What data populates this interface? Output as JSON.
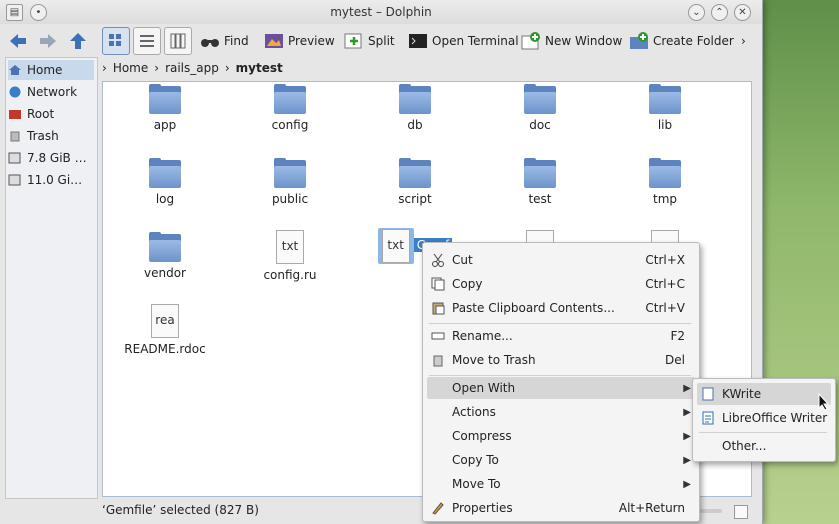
{
  "window": {
    "title": "mytest – Dolphin"
  },
  "toolbar": {
    "find": "Find",
    "preview": "Preview",
    "split": "Split",
    "open_terminal": "Open Terminal",
    "new_window": "New Window",
    "create_folder": "Create Folder",
    "more": "›"
  },
  "places": [
    {
      "label": "Home"
    },
    {
      "label": "Network"
    },
    {
      "label": "Root"
    },
    {
      "label": "Trash"
    },
    {
      "label": "7.8 GiB …"
    },
    {
      "label": "11.0 Gi…"
    }
  ],
  "breadcrumb": [
    "Home",
    "rails_app",
    "mytest"
  ],
  "files": [
    {
      "name": "app"
    },
    {
      "name": "config"
    },
    {
      "name": "db"
    },
    {
      "name": "doc"
    },
    {
      "name": "lib"
    },
    {
      "name": "log"
    },
    {
      "name": "public"
    },
    {
      "name": "script"
    },
    {
      "name": "test"
    },
    {
      "name": "tmp"
    },
    {
      "name": "vendor"
    },
    {
      "name": "config.ru"
    },
    {
      "name": "Gemf"
    },
    {
      "name": "README.rdoc"
    }
  ],
  "icon_text": {
    "txt": "txt",
    "rea": "rea"
  },
  "status": "‘Gemfile’ selected (827 B)",
  "context_menu": [
    {
      "label": "Cut",
      "shortcut": "Ctrl+X"
    },
    {
      "label": "Copy",
      "shortcut": "Ctrl+C"
    },
    {
      "label": "Paste Clipboard Contents...",
      "shortcut": "Ctrl+V"
    },
    {
      "label": "Rename...",
      "shortcut": "F2"
    },
    {
      "label": "Move to Trash",
      "shortcut": "Del"
    },
    {
      "label": "Open With",
      "shortcut": ""
    },
    {
      "label": "Actions",
      "shortcut": ""
    },
    {
      "label": "Compress",
      "shortcut": ""
    },
    {
      "label": "Copy To",
      "shortcut": ""
    },
    {
      "label": "Move To",
      "shortcut": ""
    },
    {
      "label": "Properties",
      "shortcut": "Alt+Return"
    }
  ],
  "submenu": [
    {
      "label": "KWrite"
    },
    {
      "label": "LibreOffice Writer"
    },
    {
      "label": "Other..."
    }
  ]
}
